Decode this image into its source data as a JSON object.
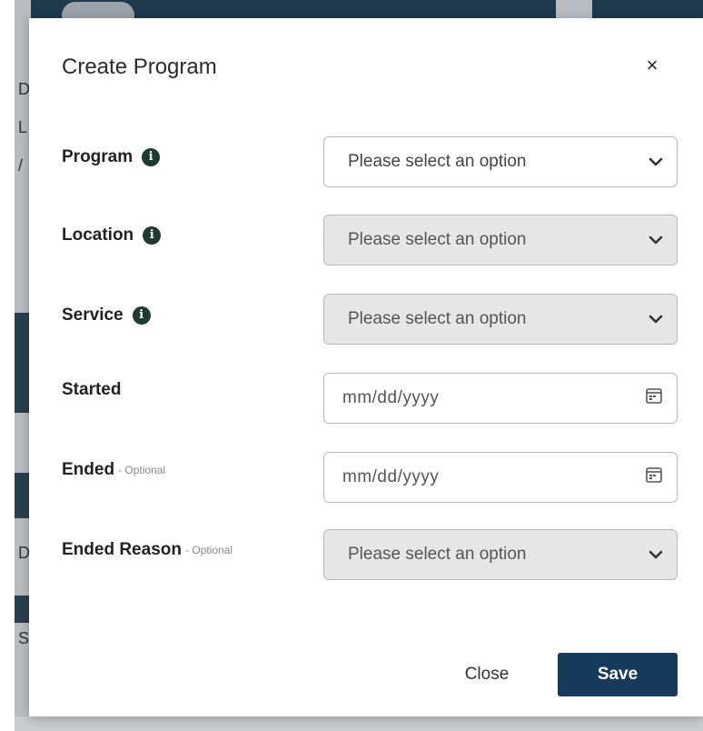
{
  "modal": {
    "title": "Create Program",
    "close_icon": "close-icon"
  },
  "fields": {
    "program": {
      "label": "Program",
      "placeholder": "Please select an option",
      "info_icon": "info-icon"
    },
    "location": {
      "label": "Location",
      "placeholder": "Please select an option",
      "info_icon": "info-icon"
    },
    "service": {
      "label": "Service",
      "placeholder": "Please select an option",
      "info_icon": "info-icon"
    },
    "started": {
      "label": "Started",
      "placeholder": "mm/dd/yyyy",
      "icon": "calendar-icon"
    },
    "ended": {
      "label": "Ended",
      "optional": "- Optional",
      "placeholder": "mm/dd/yyyy",
      "icon": "calendar-icon"
    },
    "ended_reason": {
      "label": "Ended Reason",
      "optional": "- Optional",
      "placeholder": "Please select an option"
    }
  },
  "buttons": {
    "close": "Close",
    "save": "Save"
  },
  "backdrop_letters": [
    "D",
    "L",
    "/",
    "D",
    "S"
  ],
  "colors": {
    "primary": "#163a5c",
    "info_icon": "#1d3b2e",
    "disabled_bg": "#e6e6e6"
  }
}
